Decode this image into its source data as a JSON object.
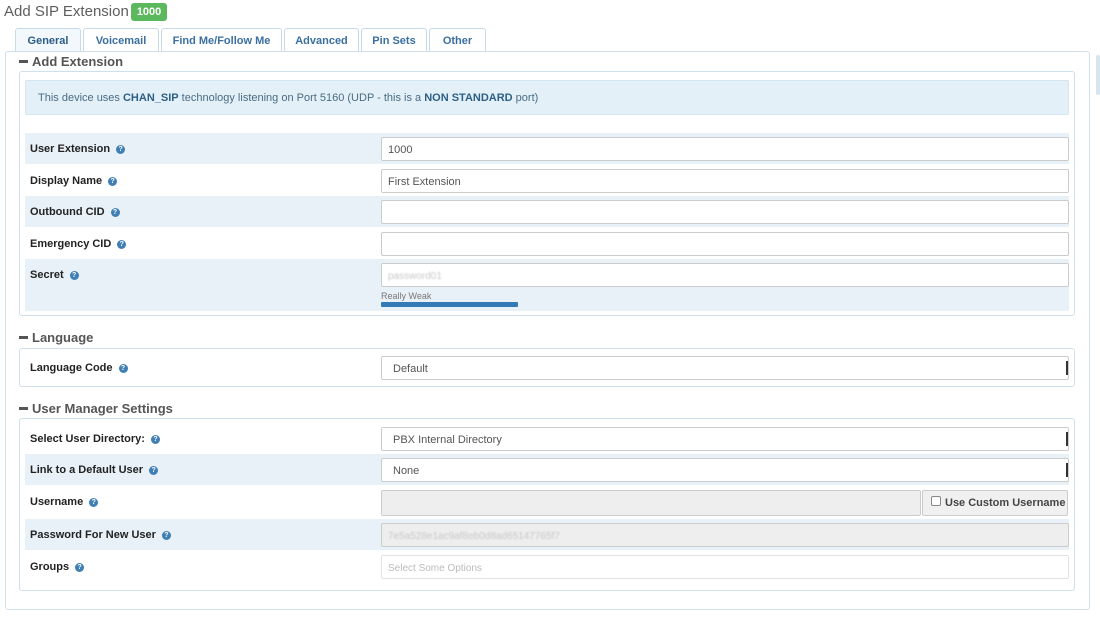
{
  "header": {
    "title": "Add SIP Extension",
    "badge": "1000"
  },
  "tabs": [
    {
      "label": "General",
      "active": true
    },
    {
      "label": "Voicemail"
    },
    {
      "label": "Find Me/Follow Me"
    },
    {
      "label": "Advanced"
    },
    {
      "label": "Pin Sets"
    },
    {
      "label": "Other"
    }
  ],
  "sections": {
    "add_extension": "Add Extension",
    "language": "Language",
    "user_manager": "User Manager Settings"
  },
  "info": {
    "prefix": "This device uses ",
    "tech": "CHAN_SIP",
    "middle": " technology listening on Port 5160 (UDP - this is a ",
    "warn": "NON STANDARD",
    "suffix": " port)"
  },
  "fields": {
    "user_extension": {
      "label": "User Extension",
      "value": "1000"
    },
    "display_name": {
      "label": "Display Name",
      "value": "First Extension"
    },
    "outbound_cid": {
      "label": "Outbound CID",
      "value": ""
    },
    "emergency_cid": {
      "label": "Emergency CID",
      "value": ""
    },
    "secret": {
      "label": "Secret",
      "value": "password01",
      "strength": "Really Weak",
      "strength_fraction": 0.2
    },
    "language_code": {
      "label": "Language Code",
      "value": "Default"
    },
    "user_directory": {
      "label": "Select User Directory:",
      "value": "PBX Internal Directory"
    },
    "default_user": {
      "label": "Link to a Default User",
      "value": "None"
    },
    "username": {
      "label": "Username",
      "value": "",
      "custom_label": "Use Custom Username"
    },
    "password_new_user": {
      "label": "Password For New User",
      "value": "7e5a528e1ac9af8eb0d8ad65147765f7"
    },
    "groups": {
      "label": "Groups",
      "placeholder": "Select Some Options"
    }
  },
  "colors": {
    "badge": "#5cb85c",
    "tab_text": "#3a6fa0",
    "info_bg": "#e3f0f7",
    "row_shade": "#e8f1f8",
    "strength_bar": "#337ab7"
  },
  "icons": {
    "help": "question-circle-icon",
    "collapse": "minus-icon"
  }
}
